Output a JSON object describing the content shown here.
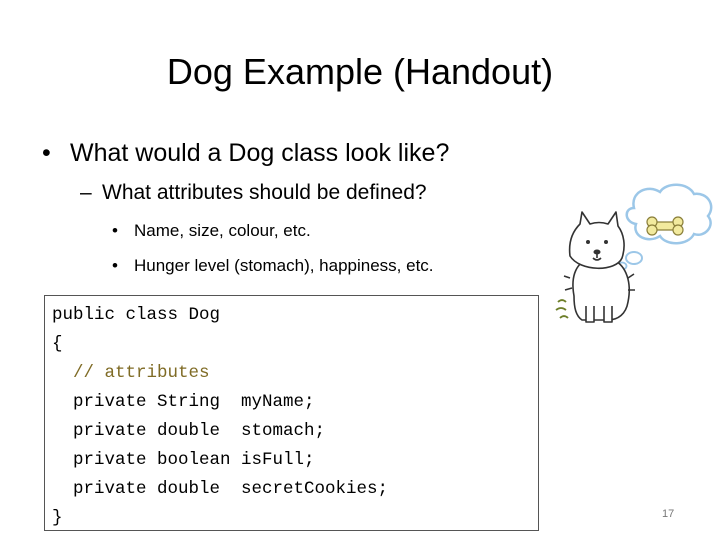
{
  "slide": {
    "title": "Dog Example (Handout)",
    "bullets": [
      {
        "level": 1,
        "marker": "•",
        "text": "What would a Dog class look like?"
      },
      {
        "level": 2,
        "marker": "–",
        "text": "What attributes should be defined?"
      },
      {
        "level": 3,
        "marker": "•",
        "text": "Name, size, colour, etc."
      },
      {
        "level": 3,
        "marker": "•",
        "text": "Hunger level (stomach), happiness, etc."
      }
    ],
    "code_lines": [
      "public class Dog",
      "{",
      "  // attributes",
      "  private String  myName;",
      "  private double  stomach;",
      "  private boolean isFull;",
      "  private double  secretCookies;",
      "}"
    ],
    "page_number": "17"
  },
  "colors": {
    "comment": "#7f6b25",
    "bone": "#f2ea9e",
    "thought_bubble": "#9cc7e8"
  },
  "illustration": {
    "icon": "dog-thinking-of-bone-icon"
  }
}
